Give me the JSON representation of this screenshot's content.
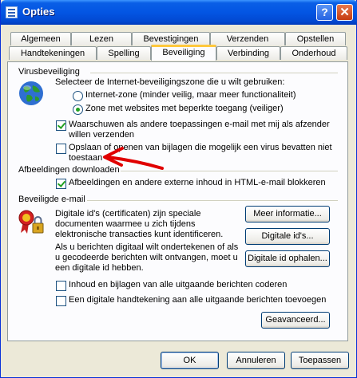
{
  "window": {
    "title": "Opties"
  },
  "tabs_row1": [
    "Algemeen",
    "Lezen",
    "Bevestigingen",
    "Verzenden",
    "Opstellen"
  ],
  "tabs_row2": [
    "Handtekeningen",
    "Spelling",
    "Beveiliging",
    "Verbinding",
    "Onderhoud"
  ],
  "virus": {
    "heading": "Virusbeveiliging",
    "zone_label": "Selecteer de Internet-beveiligingszone die u wilt gebruiken:",
    "zone_internet": "Internet-zone (minder veilig, maar meer functionaliteit)",
    "zone_restricted": "Zone met websites met beperkte toegang (veiliger)",
    "warn_line1": "Waarschuwen als andere toepassingen e-mail met mij als afzender",
    "warn_line2": "willen verzenden",
    "attach_line1": "Opslaan of openen van bijlagen die mogelijk een virus bevatten niet",
    "attach_line2": "toestaan"
  },
  "images": {
    "heading": "Afbeeldingen downloaden",
    "block_label": "Afbeeldingen en andere externe inhoud in HTML-e-mail blokkeren"
  },
  "secure": {
    "heading": "Beveiligde e-mail",
    "desc1": [
      "Digitale id's (certificaten) zijn speciale",
      "documenten waarmee u zich tijdens",
      "elektronische transacties kunt identificeren."
    ],
    "desc2": [
      "Als u berichten digitaal wilt ondertekenen of als",
      "u gecodeerde berichten wilt ontvangen, moet u",
      "een digitale id hebben."
    ],
    "more_info": "Meer informatie...",
    "digital_ids": "Digitale id's...",
    "get_id": "Digitale id ophalen...",
    "encrypt_label": "Inhoud en bijlagen van alle uitgaande berichten coderen",
    "sign_label": "Een digitale handtekening aan alle uitgaande berichten toevoegen",
    "advanced": "Geavanceerd..."
  },
  "footer": {
    "ok": "OK",
    "cancel": "Annuleren",
    "apply": "Toepassen"
  },
  "colors": {
    "annotation_arrow": "#e00000",
    "titlebar": "#0355e3",
    "check": "#21a121"
  }
}
